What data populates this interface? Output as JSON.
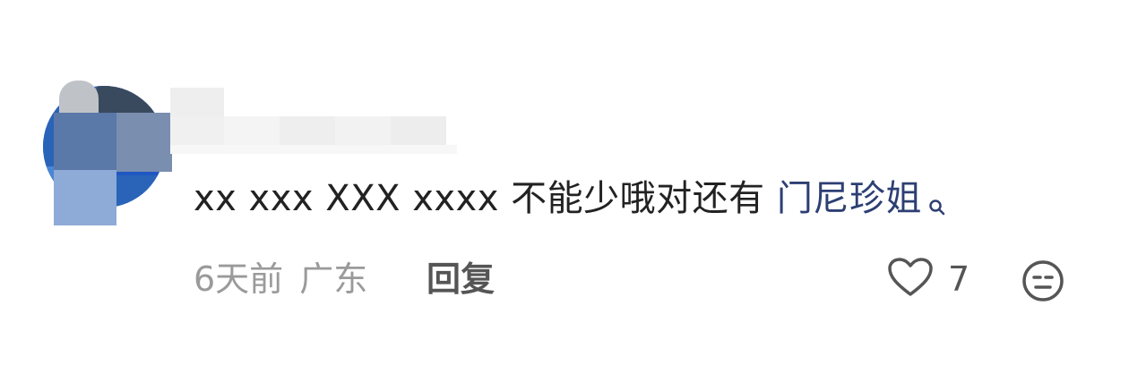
{
  "comment": {
    "text": "xx xxx XXX xxxx 不能少哦对还有 ",
    "mention": "门尼珍姐",
    "mention_icon": "search-icon",
    "time": "6天前",
    "location": "广东",
    "reply_label": "回复",
    "like_icon": "heart-outline-icon",
    "like_count": "7",
    "dislike_icon": "neutral-face-icon",
    "colors": {
      "text": "#222222",
      "mention": "#2d3f73",
      "meta": "#9a9a9a",
      "reply": "#555555"
    }
  }
}
